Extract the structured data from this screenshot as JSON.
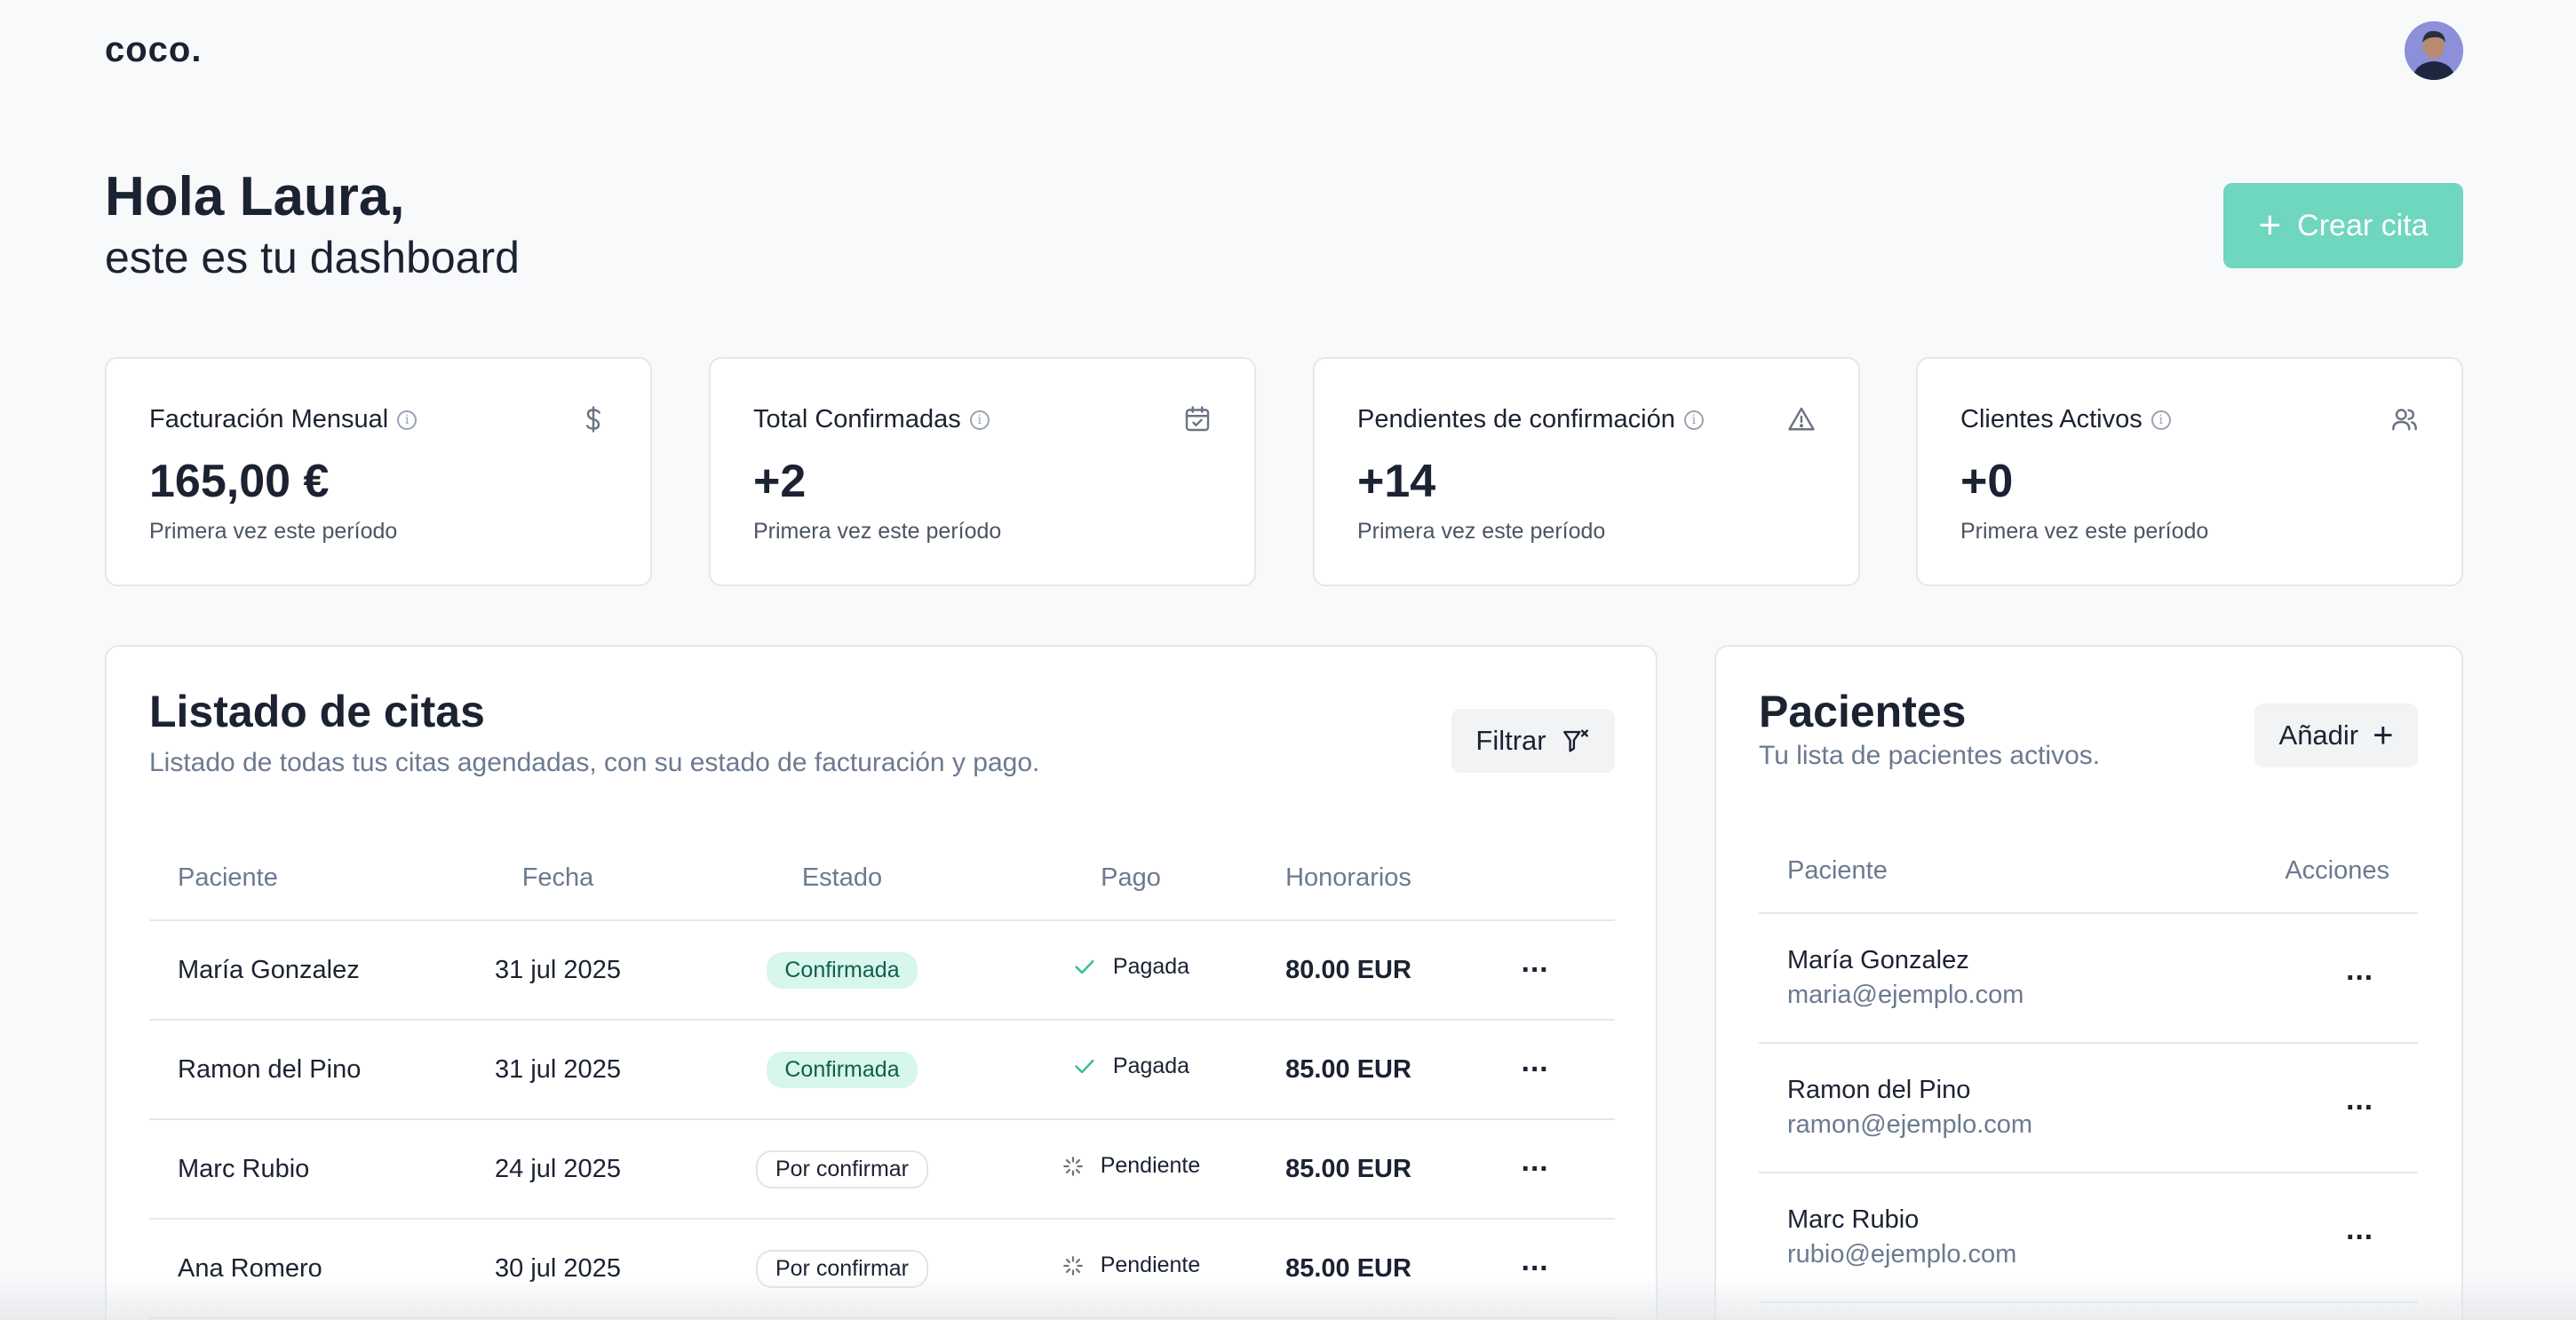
{
  "app": {
    "logo": "coco."
  },
  "header": {
    "greeting": "Hola Laura,",
    "subtitle": "este es tu dashboard",
    "create_button": "Crear cita",
    "avatar_icon": "user-avatar"
  },
  "stats": [
    {
      "title": "Facturación Mensual",
      "value": "165,00 €",
      "sub": "Primera vez este período",
      "icon": "dollar-icon"
    },
    {
      "title": "Total Confirmadas",
      "value": "+2",
      "sub": "Primera vez este período",
      "icon": "calendar-check-icon"
    },
    {
      "title": "Pendientes de confirmación",
      "value": "+14",
      "sub": "Primera vez este período",
      "icon": "warning-icon"
    },
    {
      "title": "Clientes Activos",
      "value": "+0",
      "sub": "Primera vez este período",
      "icon": "users-icon"
    }
  ],
  "citas": {
    "title": "Listado de citas",
    "subtitle": "Listado de todas tus citas agendadas, con su estado de facturación y pago.",
    "filter_label": "Filtrar",
    "columns": [
      "Paciente",
      "Fecha",
      "Estado",
      "Pago",
      "Honorarios"
    ],
    "rows": [
      {
        "patient": "María Gonzalez",
        "date": "31 jul 2025",
        "status": "Confirmada",
        "payment": "Pagada",
        "fee": "80.00 EUR"
      },
      {
        "patient": "Ramon del Pino",
        "date": "31 jul 2025",
        "status": "Confirmada",
        "payment": "Pagada",
        "fee": "85.00 EUR"
      },
      {
        "patient": "Marc Rubio",
        "date": "24 jul 2025",
        "status": "Por confirmar",
        "payment": "Pendiente",
        "fee": "85.00 EUR"
      },
      {
        "patient": "Ana Romero",
        "date": "30 jul 2025",
        "status": "Por confirmar",
        "payment": "Pendiente",
        "fee": "85.00 EUR"
      }
    ]
  },
  "pacientes": {
    "title": "Pacientes",
    "subtitle": "Tu lista de pacientes activos.",
    "add_label": "Añadir",
    "columns": [
      "Paciente",
      "Acciones"
    ],
    "rows": [
      {
        "name": "María Gonzalez",
        "email": "maria@ejemplo.com"
      },
      {
        "name": "Ramon del Pino",
        "email": "ramon@ejemplo.com"
      },
      {
        "name": "Marc Rubio",
        "email": "rubio@ejemplo.com"
      }
    ]
  },
  "colors": {
    "accent": "#6fd6bf",
    "confirmed_bg": "#d7f6ec",
    "text": "#1b2231",
    "muted": "#6b7a90"
  }
}
